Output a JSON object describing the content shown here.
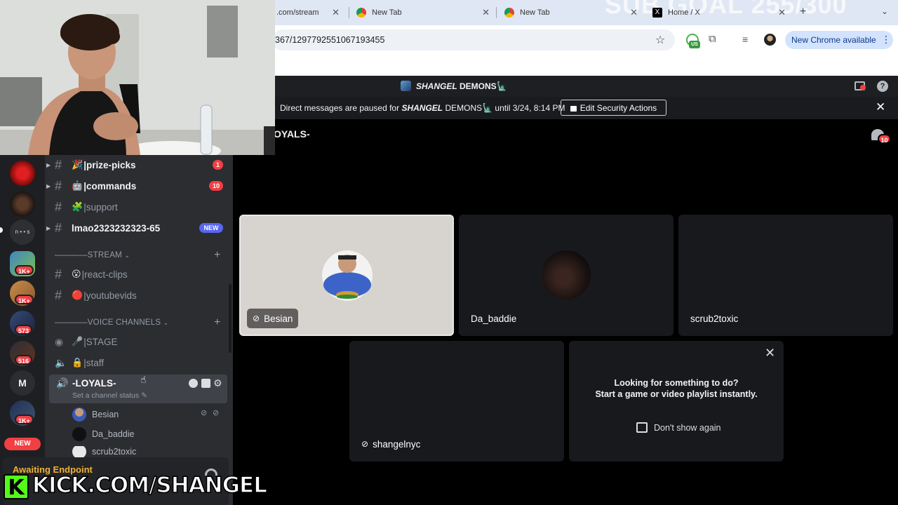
{
  "browser": {
    "tabs": [
      {
        "label": ".com/stream"
      },
      {
        "label": "New Tab"
      },
      {
        "label": "New Tab"
      },
      {
        "label": "Home / X"
      }
    ],
    "watermark": "SUB GOAL 255/300",
    "url": "367/1297792551067193455",
    "vpn_badge": "US",
    "update_label": "New Chrome available"
  },
  "discord": {
    "server_title_bold": "SHANGEL",
    "server_title_rest": "DEMONS🗽",
    "notice_prefix": "Direct messages are paused for",
    "notice_server": "SHANGEL",
    "notice_suffix": "DEMONS🗽 until 3/24, 8:14 PM",
    "security_button": "Edit Security Actions",
    "channel_header": "OYALS-",
    "chat_badge": "10"
  },
  "rail": {
    "badges": [
      "1K+",
      "1K+",
      "573",
      "516",
      "1K+"
    ],
    "letter_server": "M",
    "new_label": "NEW",
    "text_server": "n • • s"
  },
  "sidebar": {
    "channels": [
      {
        "emoji": "🎉",
        "name": "|prize-picks",
        "count": "1"
      },
      {
        "emoji": "🤖",
        "name": "|commands",
        "count": "10"
      },
      {
        "emoji": "🧩",
        "name": "|support",
        "count": ""
      },
      {
        "emoji": "",
        "name": "lmao2323232323-65",
        "count": ""
      }
    ],
    "new_pill": "NEW",
    "stream_category": "————STREAM",
    "stream_channels": [
      {
        "emoji": "😮",
        "name": "|react-clips"
      },
      {
        "emoji": "🔴",
        "name": "|youtubevids"
      }
    ],
    "voice_category": "————VOICE CHANNELS",
    "voice_channels": [
      {
        "emoji": "🎤",
        "name": "|STAGE"
      },
      {
        "emoji": "🔒",
        "name": "|staff"
      }
    ],
    "active_voice": "-LOYALS-",
    "active_voice_status": "Set a channel status",
    "voice_users": [
      "Besian",
      "Da_baddie",
      "scrub2toxic"
    ],
    "voice_status": "Awaiting Endpoint"
  },
  "grid": {
    "tiles": [
      "Besian",
      "Da_baddie",
      "scrub2toxic",
      "shangelnyc"
    ],
    "activity_line1": "Looking for something to do?",
    "activity_line2": "Start a game or video playlist instantly.",
    "dont_show": "Don't show again"
  },
  "overlay": {
    "kick_logo": "K",
    "kick_url": "KICK.COM/SHANGEL"
  }
}
